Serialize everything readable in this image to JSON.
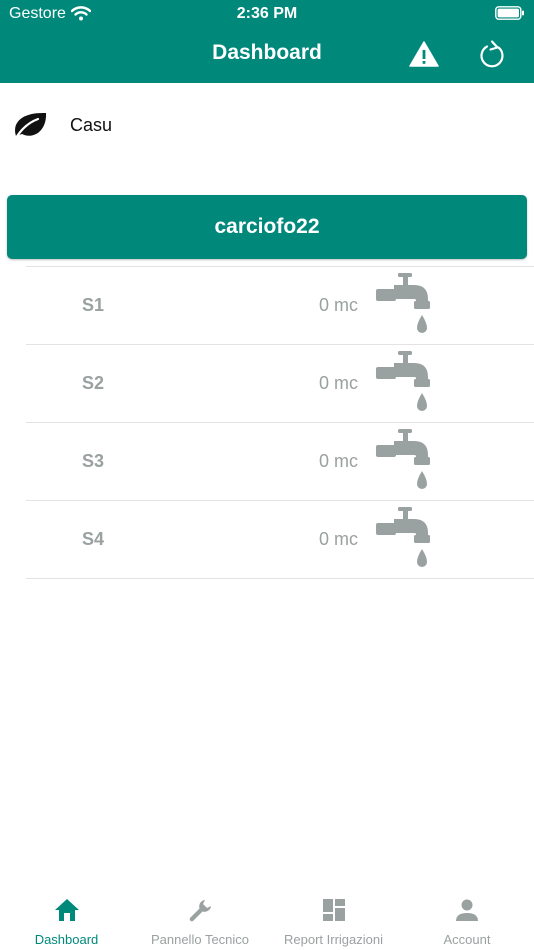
{
  "status_bar": {
    "carrier": "Gestore",
    "time": "2:36 PM"
  },
  "header": {
    "title": "Dashboard"
  },
  "colors": {
    "primary": "#00897b",
    "muted": "#9aa1a1"
  },
  "farm": {
    "name": "Casu",
    "icon": "leaf-icon"
  },
  "plot": {
    "name": "carciofo22"
  },
  "sectors": [
    {
      "name": "S1",
      "volume": "0 mc"
    },
    {
      "name": "S2",
      "volume": "0 mc"
    },
    {
      "name": "S3",
      "volume": "0 mc"
    },
    {
      "name": "S4",
      "volume": "0 mc"
    }
  ],
  "tabs": [
    {
      "label": "Dashboard",
      "icon": "home-icon",
      "active": true
    },
    {
      "label": "Pannello Tecnico",
      "icon": "wrench-icon",
      "active": false
    },
    {
      "label": "Report Irrigazioni",
      "icon": "grid-icon",
      "active": false
    },
    {
      "label": "Account",
      "icon": "user-icon",
      "active": false
    }
  ]
}
